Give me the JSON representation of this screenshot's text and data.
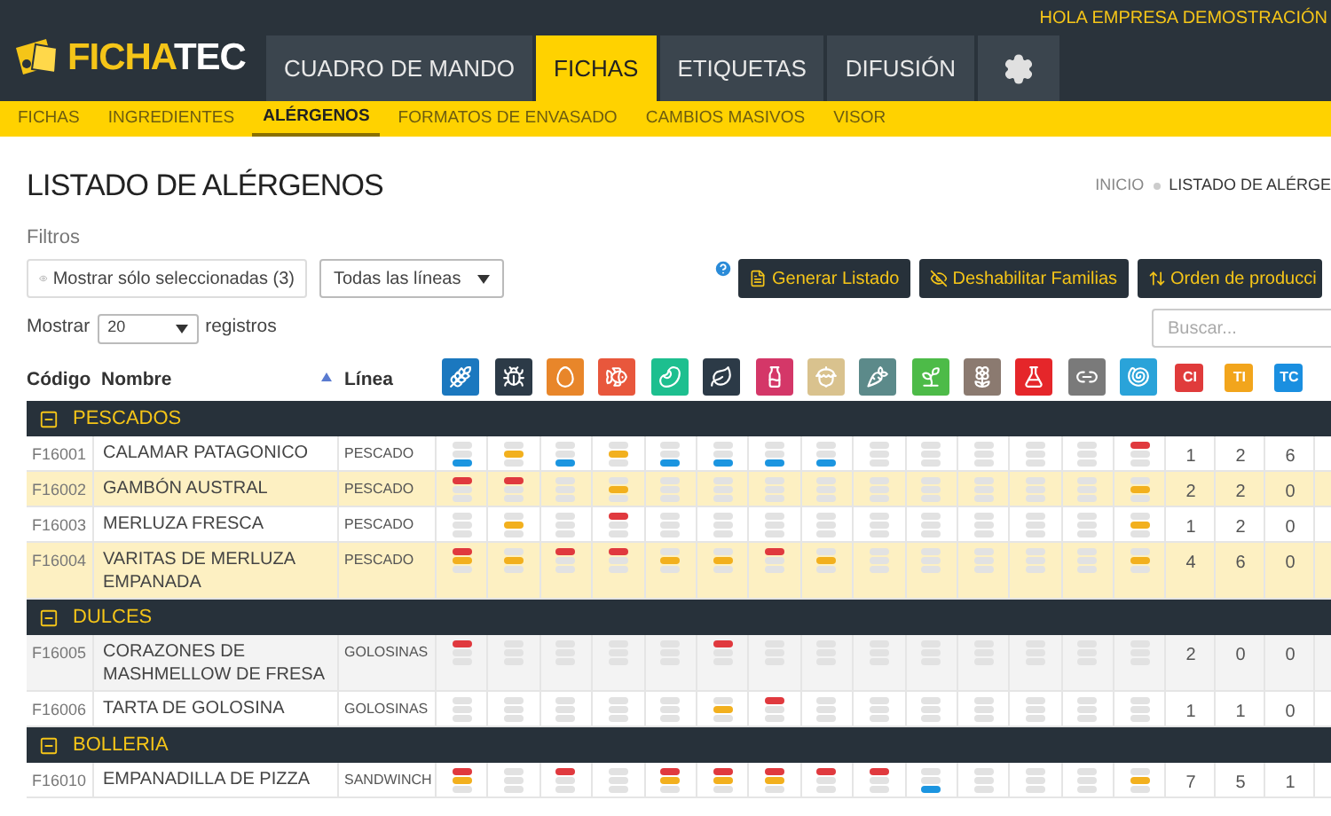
{
  "header": {
    "greeting": "HOLA EMPRESA DEMOSTRACIÓN",
    "logo": {
      "first": "FICHA",
      "second": "TEC"
    },
    "tabs": [
      {
        "kind": "text",
        "label": "CUADRO DE MANDO",
        "selected": false
      },
      {
        "kind": "text",
        "label": "FICHAS",
        "selected": true
      },
      {
        "kind": "text",
        "label": "ETIQUETAS",
        "selected": false
      },
      {
        "kind": "text",
        "label": "DIFUSIÓN",
        "selected": false
      },
      {
        "kind": "settings",
        "selected": false
      }
    ]
  },
  "subnav": [
    {
      "label": "FICHAS",
      "selected": false
    },
    {
      "label": "INGREDIENTES",
      "selected": false
    },
    {
      "label": "ALÉRGENOS",
      "selected": true
    },
    {
      "label": "FORMATOS DE ENVASADO",
      "selected": false
    },
    {
      "label": "CAMBIOS MASIVOS",
      "selected": false
    },
    {
      "label": "VISOR",
      "selected": false
    }
  ],
  "page": {
    "title": "LISTADO DE ALÉRGENOS",
    "breadcrumb": [
      "INICIO",
      "LISTADO DE ALÉRGE"
    ]
  },
  "filters": {
    "label": "Filtros",
    "show_selected_button": "Mostrar sólo seleccionadas (3)",
    "line_select": "Todas las líneas"
  },
  "actions": [
    {
      "kind": "pdf",
      "label": "Generar Listado"
    },
    {
      "kind": "hide",
      "label": "Deshabilitar Familias"
    },
    {
      "kind": "sort",
      "label": "Orden de producci"
    }
  ],
  "page_size": {
    "before": "Mostrar",
    "value": "20",
    "after": "registros"
  },
  "search": {
    "placeholder": "Buscar..."
  },
  "table": {
    "columns": {
      "code": "Código",
      "name": "Nombre",
      "line": "Línea"
    },
    "allergens": [
      {
        "color": "#1b78bf"
      },
      {
        "color": "#2c3a47"
      },
      {
        "color": "#e8862a"
      },
      {
        "color": "#e8573c"
      },
      {
        "color": "#1dbf8f"
      },
      {
        "color": "#2c3a47"
      },
      {
        "color": "#d43768"
      },
      {
        "color": "#d9c28e"
      },
      {
        "color": "#5c8a8a"
      },
      {
        "color": "#4dbb48"
      },
      {
        "color": "#8b7a70"
      },
      {
        "color": "#e5262a"
      },
      {
        "color": "#7a7a7a"
      },
      {
        "color": "#2aa3d9"
      }
    ],
    "totals": [
      {
        "label": "CI",
        "color": "#e03b3b"
      },
      {
        "label": "TI",
        "color": "#f2a51c"
      },
      {
        "label": "TC",
        "color": "#1a8fe0"
      }
    ],
    "groups": [
      {
        "name": "PESCADOS",
        "expanded": true,
        "rows": [
          {
            "code": "F16001",
            "name": "CALAMAR PATAGONICO",
            "line": "PESCADO",
            "selected": false,
            "hovered": false,
            "totals": [
              "1",
              "2",
              "6"
            ],
            "marks": [
              {
                "red": false,
                "orange": false,
                "blue": true
              },
              {
                "red": false,
                "orange": true,
                "blue": false
              },
              {
                "red": false,
                "orange": false,
                "blue": true
              },
              {
                "red": false,
                "orange": true,
                "blue": false
              },
              {
                "red": false,
                "orange": false,
                "blue": true
              },
              {
                "red": false,
                "orange": false,
                "blue": true
              },
              {
                "red": false,
                "orange": false,
                "blue": true
              },
              {
                "red": false,
                "orange": false,
                "blue": true
              },
              {
                "red": false,
                "orange": false,
                "blue": false
              },
              {
                "red": false,
                "orange": false,
                "blue": false
              },
              {
                "red": false,
                "orange": false,
                "blue": false
              },
              {
                "red": false,
                "orange": false,
                "blue": false
              },
              {
                "red": false,
                "orange": false,
                "blue": false
              },
              {
                "red": true,
                "orange": false,
                "blue": false
              }
            ]
          },
          {
            "code": "F16002",
            "name": "GAMBÓN AUSTRAL",
            "line": "PESCADO",
            "selected": true,
            "hovered": false,
            "totals": [
              "2",
              "2",
              "0"
            ],
            "marks": [
              {
                "red": true,
                "orange": false,
                "blue": false
              },
              {
                "red": true,
                "orange": false,
                "blue": false
              },
              {
                "red": false,
                "orange": false,
                "blue": false
              },
              {
                "red": false,
                "orange": true,
                "blue": false
              },
              {
                "red": false,
                "orange": false,
                "blue": false
              },
              {
                "red": false,
                "orange": false,
                "blue": false
              },
              {
                "red": false,
                "orange": false,
                "blue": false
              },
              {
                "red": false,
                "orange": false,
                "blue": false
              },
              {
                "red": false,
                "orange": false,
                "blue": false
              },
              {
                "red": false,
                "orange": false,
                "blue": false
              },
              {
                "red": false,
                "orange": false,
                "blue": false
              },
              {
                "red": false,
                "orange": false,
                "blue": false
              },
              {
                "red": false,
                "orange": false,
                "blue": false
              },
              {
                "red": false,
                "orange": true,
                "blue": false
              }
            ]
          },
          {
            "code": "F16003",
            "name": "MERLUZA FRESCA",
            "line": "PESCADO",
            "selected": false,
            "hovered": false,
            "totals": [
              "1",
              "2",
              "0"
            ],
            "marks": [
              {
                "red": false,
                "orange": false,
                "blue": false
              },
              {
                "red": false,
                "orange": true,
                "blue": false
              },
              {
                "red": false,
                "orange": false,
                "blue": false
              },
              {
                "red": true,
                "orange": false,
                "blue": false
              },
              {
                "red": false,
                "orange": false,
                "blue": false
              },
              {
                "red": false,
                "orange": false,
                "blue": false
              },
              {
                "red": false,
                "orange": false,
                "blue": false
              },
              {
                "red": false,
                "orange": false,
                "blue": false
              },
              {
                "red": false,
                "orange": false,
                "blue": false
              },
              {
                "red": false,
                "orange": false,
                "blue": false
              },
              {
                "red": false,
                "orange": false,
                "blue": false
              },
              {
                "red": false,
                "orange": false,
                "blue": false
              },
              {
                "red": false,
                "orange": false,
                "blue": false
              },
              {
                "red": false,
                "orange": true,
                "blue": false
              }
            ]
          },
          {
            "code": "F16004",
            "name": "VARITAS DE MERLUZA EMPANADA",
            "line": "PESCADO",
            "selected": true,
            "hovered": false,
            "totals": [
              "4",
              "6",
              "0"
            ],
            "marks": [
              {
                "red": true,
                "orange": true,
                "blue": false
              },
              {
                "red": false,
                "orange": true,
                "blue": false
              },
              {
                "red": true,
                "orange": false,
                "blue": false
              },
              {
                "red": true,
                "orange": false,
                "blue": false
              },
              {
                "red": false,
                "orange": true,
                "blue": false
              },
              {
                "red": false,
                "orange": true,
                "blue": false
              },
              {
                "red": true,
                "orange": false,
                "blue": false
              },
              {
                "red": false,
                "orange": true,
                "blue": false
              },
              {
                "red": false,
                "orange": false,
                "blue": false
              },
              {
                "red": false,
                "orange": false,
                "blue": false
              },
              {
                "red": false,
                "orange": false,
                "blue": false
              },
              {
                "red": false,
                "orange": false,
                "blue": false
              },
              {
                "red": false,
                "orange": false,
                "blue": false
              },
              {
                "red": false,
                "orange": true,
                "blue": false
              }
            ]
          }
        ]
      },
      {
        "name": "DULCES",
        "expanded": true,
        "rows": [
          {
            "code": "F16005",
            "name": "CORAZONES DE MASHMELLOW DE FRESA",
            "line": "GOLOSINAS",
            "selected": false,
            "hovered": true,
            "totals": [
              "2",
              "0",
              "0"
            ],
            "marks": [
              {
                "red": true,
                "orange": false,
                "blue": false
              },
              {
                "red": false,
                "orange": false,
                "blue": false
              },
              {
                "red": false,
                "orange": false,
                "blue": false
              },
              {
                "red": false,
                "orange": false,
                "blue": false
              },
              {
                "red": false,
                "orange": false,
                "blue": false
              },
              {
                "red": true,
                "orange": false,
                "blue": false
              },
              {
                "red": false,
                "orange": false,
                "blue": false
              },
              {
                "red": false,
                "orange": false,
                "blue": false
              },
              {
                "red": false,
                "orange": false,
                "blue": false
              },
              {
                "red": false,
                "orange": false,
                "blue": false
              },
              {
                "red": false,
                "orange": false,
                "blue": false
              },
              {
                "red": false,
                "orange": false,
                "blue": false
              },
              {
                "red": false,
                "orange": false,
                "blue": false
              },
              {
                "red": false,
                "orange": false,
                "blue": false
              }
            ]
          },
          {
            "code": "F16006",
            "name": "TARTA DE GOLOSINA",
            "line": "GOLOSINAS",
            "selected": false,
            "hovered": false,
            "totals": [
              "1",
              "1",
              "0"
            ],
            "marks": [
              {
                "red": false,
                "orange": false,
                "blue": false
              },
              {
                "red": false,
                "orange": false,
                "blue": false
              },
              {
                "red": false,
                "orange": false,
                "blue": false
              },
              {
                "red": false,
                "orange": false,
                "blue": false
              },
              {
                "red": false,
                "orange": false,
                "blue": false
              },
              {
                "red": false,
                "orange": true,
                "blue": false
              },
              {
                "red": true,
                "orange": false,
                "blue": false
              },
              {
                "red": false,
                "orange": false,
                "blue": false
              },
              {
                "red": false,
                "orange": false,
                "blue": false
              },
              {
                "red": false,
                "orange": false,
                "blue": false
              },
              {
                "red": false,
                "orange": false,
                "blue": false
              },
              {
                "red": false,
                "orange": false,
                "blue": false
              },
              {
                "red": false,
                "orange": false,
                "blue": false
              },
              {
                "red": false,
                "orange": false,
                "blue": false
              }
            ]
          }
        ]
      },
      {
        "name": "BOLLERIA",
        "expanded": true,
        "rows": [
          {
            "code": "F16010",
            "name": "EMPANADILLA DE PIZZA",
            "line": "SANDWINCH",
            "selected": false,
            "hovered": false,
            "totals": [
              "7",
              "5",
              "1"
            ],
            "marks": [
              {
                "red": true,
                "orange": true,
                "blue": false
              },
              {
                "red": false,
                "orange": false,
                "blue": false
              },
              {
                "red": true,
                "orange": false,
                "blue": false
              },
              {
                "red": false,
                "orange": false,
                "blue": false
              },
              {
                "red": true,
                "orange": true,
                "blue": false
              },
              {
                "red": true,
                "orange": true,
                "blue": false
              },
              {
                "red": true,
                "orange": true,
                "blue": false
              },
              {
                "red": true,
                "orange": false,
                "blue": false
              },
              {
                "red": true,
                "orange": false,
                "blue": false
              },
              {
                "red": false,
                "orange": false,
                "blue": true
              },
              {
                "red": false,
                "orange": false,
                "blue": false
              },
              {
                "red": false,
                "orange": false,
                "blue": false
              },
              {
                "red": false,
                "orange": false,
                "blue": false
              },
              {
                "red": false,
                "orange": true,
                "blue": false
              }
            ]
          }
        ]
      }
    ]
  }
}
